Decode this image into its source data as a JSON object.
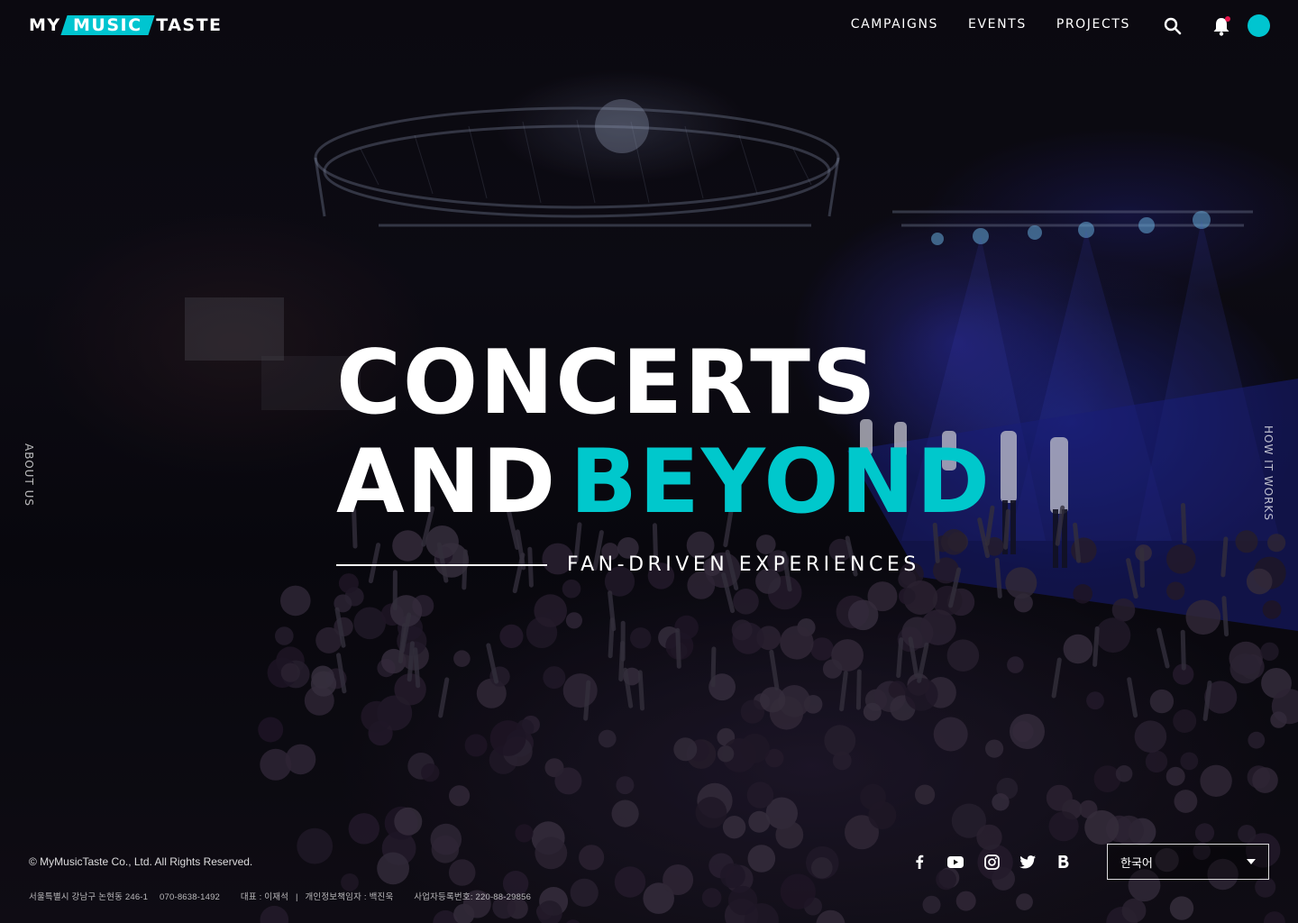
{
  "brand": {
    "logo_my": "MY",
    "logo_music": "MUSIC",
    "logo_taste": "TASTE",
    "accent_color": "#00c5d0"
  },
  "nav": {
    "items": [
      {
        "label": "CAMPAIGNS"
      },
      {
        "label": "EVENTS"
      },
      {
        "label": "PROJECTS"
      }
    ],
    "icons": [
      "search-icon",
      "bell-icon",
      "avatar"
    ]
  },
  "side": {
    "left_label": "ABOUT US",
    "right_label": "HOW IT WORKS"
  },
  "hero": {
    "line1": "CONCERTS",
    "line2_white": "AND",
    "line2_accent": "BEYOND",
    "tagline": "FAN-DRIVEN EXPERIENCES"
  },
  "footer": {
    "copyright": "© MyMusicTaste Co., Ltd. All Rights Reserved.",
    "address": "서울특별시 강남구 논현동 246-1",
    "phone": "070-8638-1492",
    "ceo": "대표 : 이재석",
    "privacy_officer": "개인정보책임자 : 백진욱",
    "business_number": "사업자등록번호: 220-88-29856",
    "socials": [
      "facebook-icon",
      "youtube-icon",
      "instagram-icon",
      "twitter-icon",
      "blog-icon"
    ],
    "language_selected": "한국어"
  }
}
